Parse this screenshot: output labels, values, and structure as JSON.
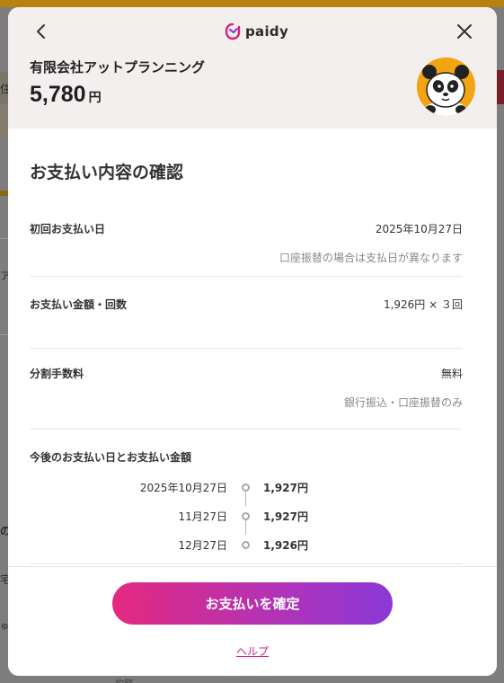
{
  "background": {
    "side_fragments": [
      "住入",
      "ア",
      "の",
      "宅",
      "ゅ"
    ],
    "bottom_fragment": "約額"
  },
  "header": {
    "logo_text": "paidy",
    "merchant_name": "有限会社アットプランニング",
    "amount": "5,780",
    "currency": "円",
    "back_icon": "chevron-left-icon",
    "close_icon": "close-icon"
  },
  "confirmation": {
    "title": "お支払い内容の確認",
    "first_payment": {
      "label": "初回お支払い日",
      "value": "2025年10月27日",
      "note": "口座振替の場合は支払日が異なります"
    },
    "amount_count": {
      "label": "お支払い金額・回数",
      "value": "1,926円 × ３回"
    },
    "fee": {
      "label": "分割手数料",
      "value": "無料",
      "note": "銀行振込・口座振替のみ"
    },
    "schedule": {
      "label": "今後のお支払い日とお支払い金額",
      "rows": [
        {
          "date": "2025年10月27日",
          "amount": "1,927円"
        },
        {
          "date": "11月27日",
          "amount": "1,927円"
        },
        {
          "date": "12月27日",
          "amount": "1,926円"
        }
      ]
    }
  },
  "footer": {
    "confirm_label": "お支払いを確定",
    "help_label": "ヘルプ"
  },
  "colors": {
    "accent_start": "#e5297f",
    "accent_end": "#8b38d8",
    "header_bg": "#f3efee"
  }
}
